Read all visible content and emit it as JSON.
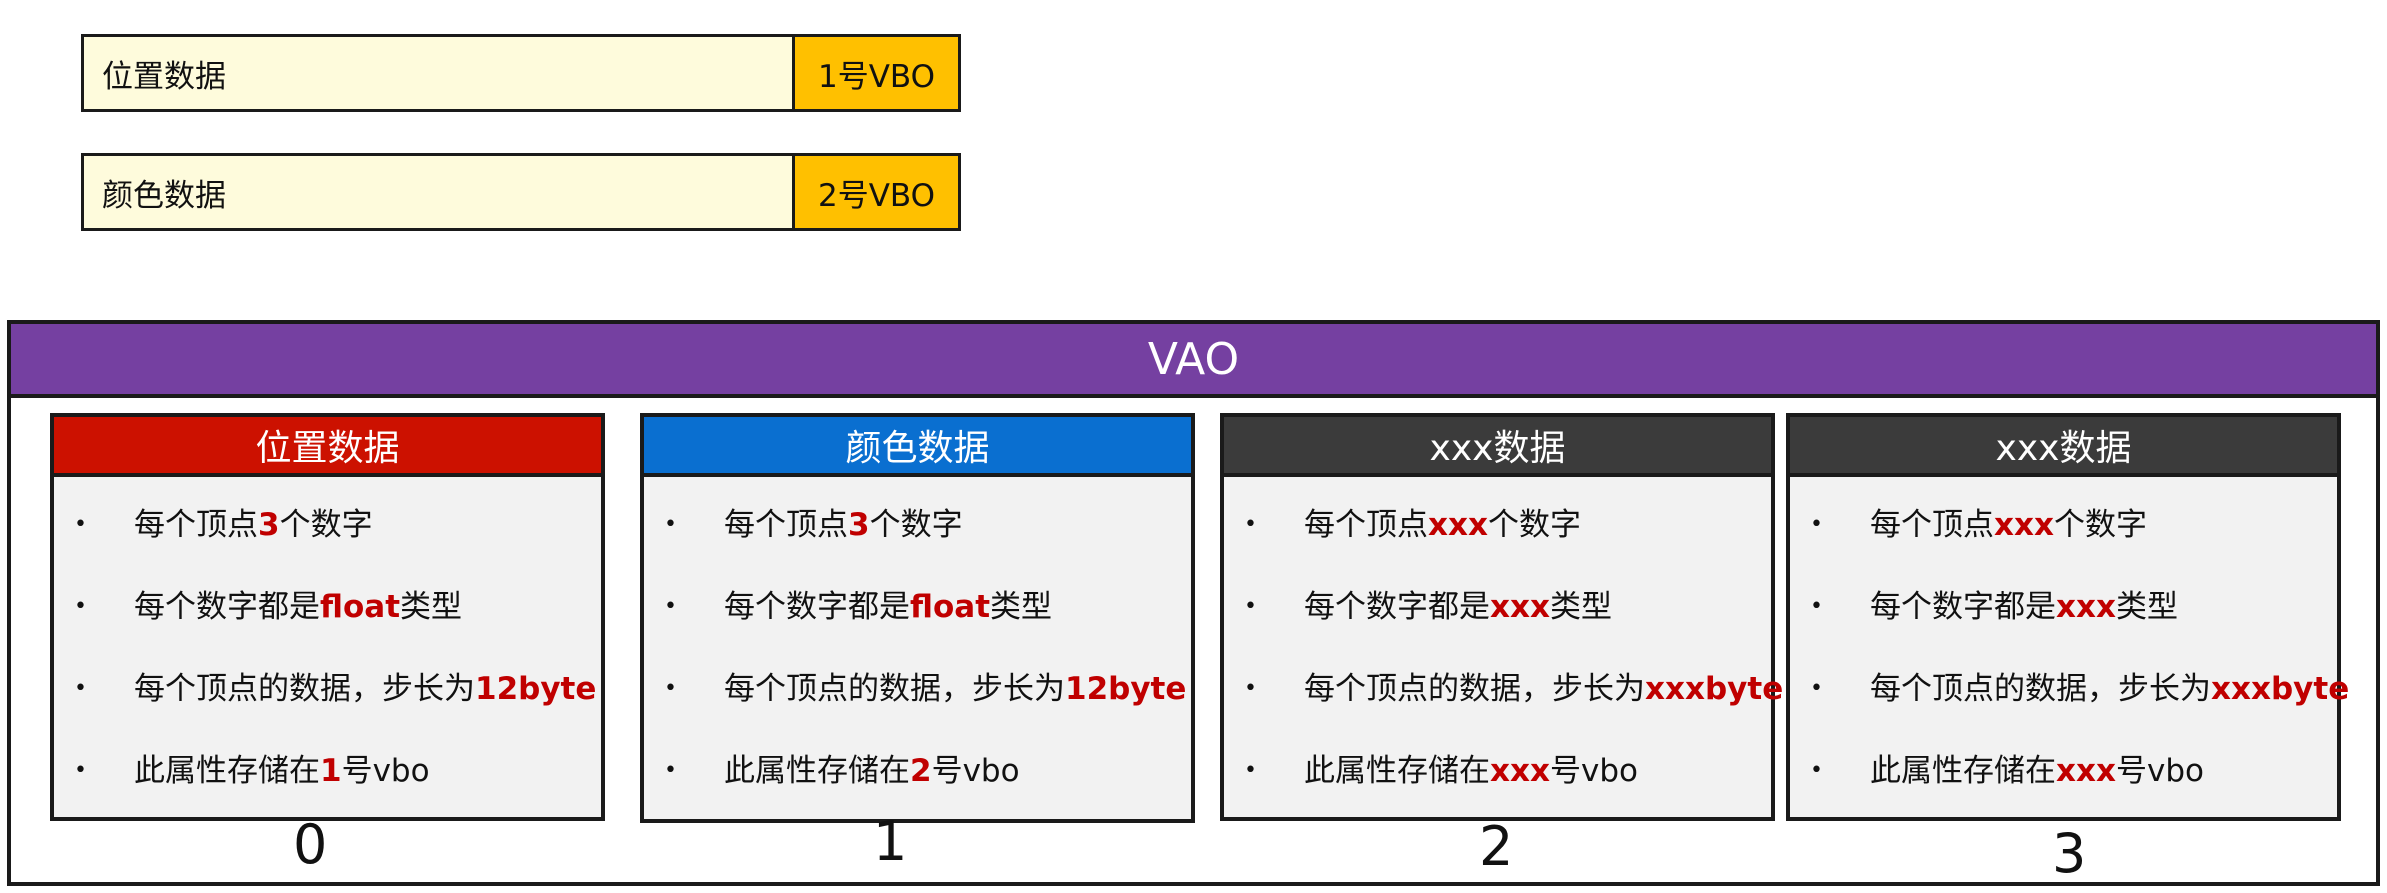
{
  "vbos": [
    {
      "name": "位置数据",
      "tag": "1号VBO"
    },
    {
      "name": "颜色数据",
      "tag": "2号VBO"
    }
  ],
  "vao": {
    "title": "VAO",
    "attributes": [
      {
        "index": "0",
        "title": "位置数据",
        "color": "#cc1100",
        "lines": [
          [
            "每个顶点",
            "3",
            "个数字"
          ],
          [
            "每个数字都是",
            "float",
            "类型"
          ],
          [
            "每个顶点的数据，步长为",
            "12byte",
            ""
          ],
          [
            "此属性存储在",
            "1",
            "号vbo"
          ]
        ]
      },
      {
        "index": "1",
        "title": "颜色数据",
        "color": "#0a6fd0",
        "lines": [
          [
            "每个顶点",
            "3",
            "个数字"
          ],
          [
            "每个数字都是",
            "float",
            "类型"
          ],
          [
            "每个顶点的数据，步长为",
            "12byte",
            ""
          ],
          [
            "此属性存储在",
            "2",
            "号vbo"
          ]
        ]
      },
      {
        "index": "2",
        "title": "xxx数据",
        "color": "#3b3b3b",
        "lines": [
          [
            "每个顶点",
            "xxx",
            "个数字"
          ],
          [
            "每个数字都是",
            "xxx",
            "类型"
          ],
          [
            "每个顶点的数据，步长为",
            "xxxbyte",
            ""
          ],
          [
            "此属性存储在",
            "xxx",
            "号vbo"
          ]
        ]
      },
      {
        "index": "3",
        "title": "xxx数据",
        "color": "#3b3b3b",
        "lines": [
          [
            "每个顶点",
            "xxx",
            "个数字"
          ],
          [
            "每个数字都是",
            "xxx",
            "类型"
          ],
          [
            "每个顶点的数据，步长为",
            "xxxbyte",
            ""
          ],
          [
            "此属性存储在",
            "xxx",
            "号vbo"
          ]
        ]
      }
    ]
  }
}
